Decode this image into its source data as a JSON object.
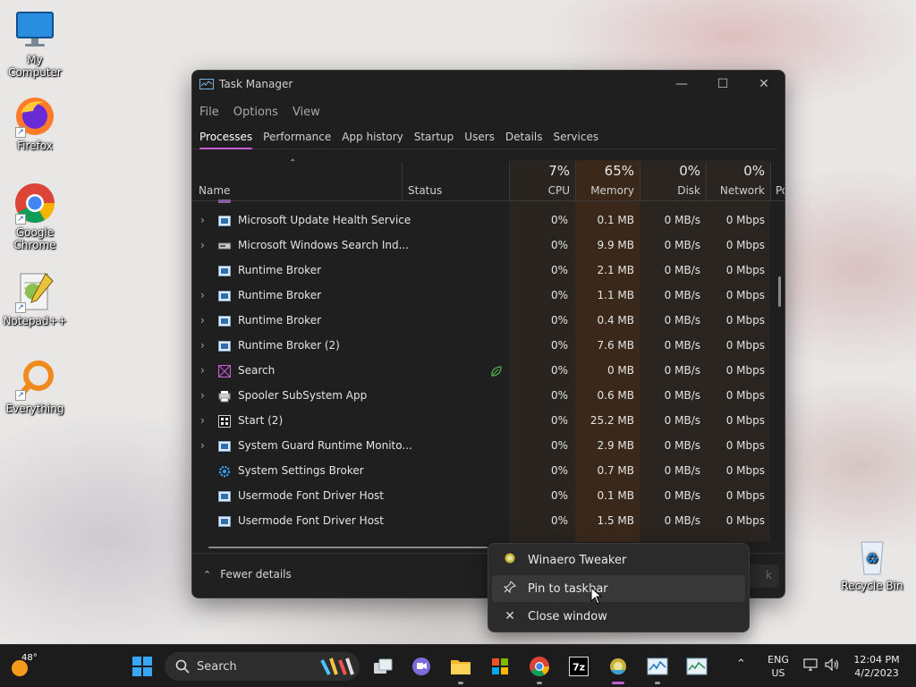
{
  "desktop": {
    "icons": [
      {
        "label": "My Computer",
        "icon": "monitor-icon"
      },
      {
        "label": "Firefox",
        "icon": "firefox-icon"
      },
      {
        "label": "Google Chrome",
        "icon": "chrome-icon"
      },
      {
        "label": "Notepad++",
        "icon": "notepad-plus-plus-icon"
      },
      {
        "label": "Everything",
        "icon": "magnifier-icon"
      },
      {
        "label": "Recycle Bin",
        "icon": "recycle-bin-icon"
      }
    ]
  },
  "window": {
    "title": "Task Manager",
    "controls": {
      "minimize": "—",
      "maximize": "☐",
      "close": "✕"
    }
  },
  "menu": [
    "File",
    "Options",
    "View"
  ],
  "tabs": [
    "Processes",
    "Performance",
    "App history",
    "Startup",
    "Users",
    "Details",
    "Services"
  ],
  "active_tab": "Processes",
  "columns": {
    "name": "Name",
    "status": "Status",
    "cpu": {
      "label": "CPU",
      "pct": "7%"
    },
    "memory": {
      "label": "Memory",
      "pct": "65%"
    },
    "disk": {
      "label": "Disk",
      "pct": "0%"
    },
    "network": {
      "label": "Network",
      "pct": "0%"
    },
    "power": "Po"
  },
  "processes": [
    {
      "name": "Microsoft Update Health Service",
      "cpu": "0%",
      "memory": "0.1 MB",
      "disk": "0 MB/s",
      "network": "0 Mbps",
      "expandable": true,
      "icon": "service-icon"
    },
    {
      "name": "Microsoft Windows Search Ind...",
      "cpu": "0%",
      "memory": "9.9 MB",
      "disk": "0 MB/s",
      "network": "0 Mbps",
      "expandable": true,
      "icon": "search-indexer-icon"
    },
    {
      "name": "Runtime Broker",
      "cpu": "0%",
      "memory": "2.1 MB",
      "disk": "0 MB/s",
      "network": "0 Mbps",
      "expandable": false,
      "icon": "service-icon"
    },
    {
      "name": "Runtime Broker",
      "cpu": "0%",
      "memory": "1.1 MB",
      "disk": "0 MB/s",
      "network": "0 Mbps",
      "expandable": true,
      "icon": "service-icon"
    },
    {
      "name": "Runtime Broker",
      "cpu": "0%",
      "memory": "0.4 MB",
      "disk": "0 MB/s",
      "network": "0 Mbps",
      "expandable": true,
      "icon": "service-icon"
    },
    {
      "name": "Runtime Broker (2)",
      "cpu": "0%",
      "memory": "7.6 MB",
      "disk": "0 MB/s",
      "network": "0 Mbps",
      "expandable": true,
      "icon": "service-icon"
    },
    {
      "name": "Search",
      "cpu": "0%",
      "memory": "0 MB",
      "disk": "0 MB/s",
      "network": "0 Mbps",
      "expandable": true,
      "icon": "search-app-icon",
      "status_icon": "leaf-icon"
    },
    {
      "name": "Spooler SubSystem App",
      "cpu": "0%",
      "memory": "0.6 MB",
      "disk": "0 MB/s",
      "network": "0 Mbps",
      "expandable": true,
      "icon": "printer-icon"
    },
    {
      "name": "Start (2)",
      "cpu": "0%",
      "memory": "25.2 MB",
      "disk": "0 MB/s",
      "network": "0 Mbps",
      "expandable": true,
      "icon": "start-icon"
    },
    {
      "name": "System Guard Runtime Monito...",
      "cpu": "0%",
      "memory": "2.9 MB",
      "disk": "0 MB/s",
      "network": "0 Mbps",
      "expandable": true,
      "icon": "service-icon"
    },
    {
      "name": "System Settings Broker",
      "cpu": "0%",
      "memory": "0.7 MB",
      "disk": "0 MB/s",
      "network": "0 Mbps",
      "expandable": false,
      "icon": "gear-icon"
    },
    {
      "name": "Usermode Font Driver Host",
      "cpu": "0%",
      "memory": "0.1 MB",
      "disk": "0 MB/s",
      "network": "0 Mbps",
      "expandable": false,
      "icon": "service-icon"
    },
    {
      "name": "Usermode Font Driver Host",
      "cpu": "0%",
      "memory": "1.5 MB",
      "disk": "0 MB/s",
      "network": "0 Mbps",
      "expandable": false,
      "icon": "service-icon"
    }
  ],
  "footer": {
    "fewer_details": "Fewer details",
    "end_task": "k"
  },
  "jumplist": {
    "app_name": "Winaero Tweaker",
    "pin": "Pin to taskbar",
    "close": "Close window"
  },
  "taskbar": {
    "weather_temp": "48°",
    "search_label": "Search",
    "lang_line1": "ENG",
    "lang_line2": "US",
    "time": "12:04 PM",
    "date": "4/2/2023"
  },
  "colors": {
    "accent": "#c85bd6",
    "window_bg": "#1f1f1f",
    "heat_memory": "#3b2a1d",
    "heat_cpu": "#2a2521"
  }
}
